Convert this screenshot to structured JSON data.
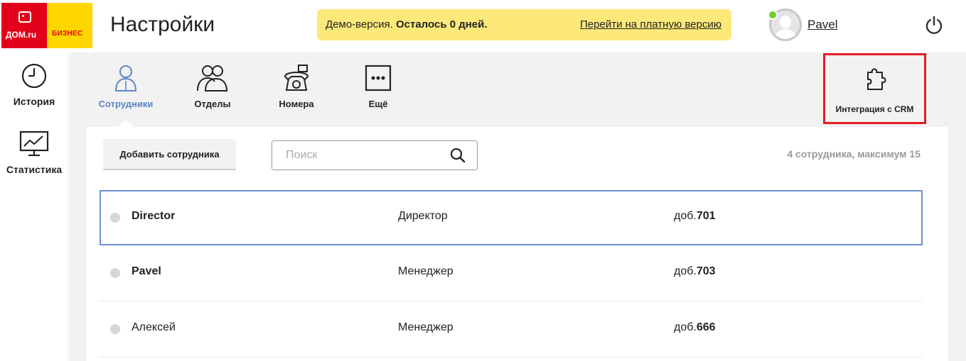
{
  "logo": {
    "brand": "ДОМ.ru",
    "tag": "БИЗНЕС"
  },
  "header": {
    "title": "Настройки",
    "demo_prefix": "Демо-версия.",
    "demo_bold": "Осталось 0 дней.",
    "demo_link": "Перейти на платную версию",
    "username": "Pavel"
  },
  "sidebar": {
    "items": [
      {
        "label": "История",
        "icon": "clock-icon"
      },
      {
        "label": "Статистика",
        "icon": "chart-monitor-icon"
      }
    ]
  },
  "tabs": [
    {
      "label": "Сотрудники",
      "icon": "user-icon",
      "active": true
    },
    {
      "label": "Отделы",
      "icon": "group-icon",
      "active": false
    },
    {
      "label": "Номера",
      "icon": "phone-icon",
      "active": false
    },
    {
      "label": "Ещё",
      "icon": "more-icon",
      "active": false
    }
  ],
  "crm": {
    "label": "Интеграция с CRM",
    "icon": "puzzle-icon"
  },
  "toolbar": {
    "add_label": "Добавить сотрудника",
    "search_placeholder": "Поиск",
    "count_text": "4 сотрудника, максимум 15"
  },
  "employees": [
    {
      "name": "Director",
      "role": "Директор",
      "ext_prefix": "доб.",
      "ext": "701",
      "bold": true
    },
    {
      "name": "Pavel",
      "role": "Менеджер",
      "ext_prefix": "доб.",
      "ext": "703",
      "bold": true
    },
    {
      "name": "Алексей",
      "role": "Менеджер",
      "ext_prefix": "доб.",
      "ext": "666",
      "bold": false
    }
  ],
  "colors": {
    "brand_red": "#e3001b",
    "brand_yellow": "#ffd600",
    "demo_bg": "#fde97a",
    "active_tab": "#5a85c7",
    "highlight_red": "#e31e24",
    "online": "#6bd12a"
  }
}
